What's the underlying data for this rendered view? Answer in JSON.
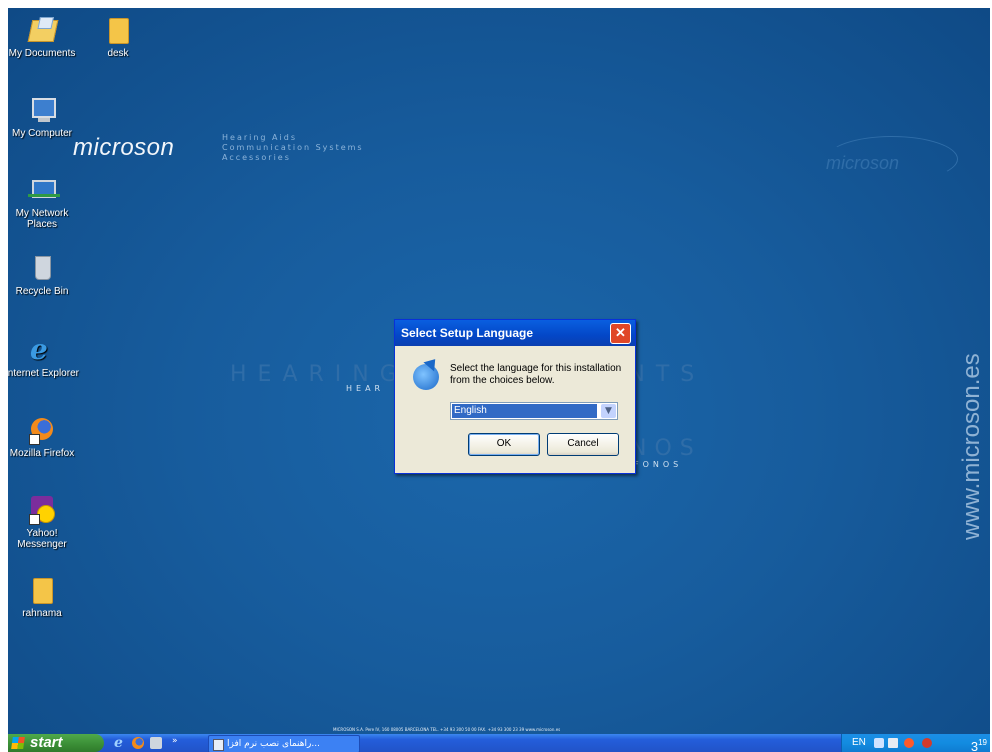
{
  "desktop": {
    "icons": [
      {
        "label": "My Documents"
      },
      {
        "label": "desk"
      },
      {
        "label": "My Computer"
      },
      {
        "label": "My Network Places"
      },
      {
        "label": "Recycle Bin"
      },
      {
        "label": "Internet Explorer"
      },
      {
        "label": "Mozilla Firefox"
      },
      {
        "label": "Yahoo! Messenger"
      },
      {
        "label": "rahnama"
      }
    ]
  },
  "wallpaper": {
    "logo": "microson",
    "tagline": [
      "Hearing Aids",
      "Communication Systems",
      "Accessories"
    ],
    "logo_right": "microson",
    "hearing_big": "HEARING INSTRUMENTS",
    "hearing_small": "HEAR",
    "fonos_big": "NOS",
    "fonos_small": "FONOS",
    "website": "www.microson.es",
    "footer": "MICROSON S.A. Pere IV, 160 08005 BARCELONA TEL. +34 93 300 50 00 FAX. +34 93 300 23 39 www.microson.es"
  },
  "dialog": {
    "title": "Select Setup Language",
    "message": "Select the language for this installation from the choices below.",
    "selected_language": "English",
    "ok_label": "OK",
    "cancel_label": "Cancel"
  },
  "taskbar": {
    "start_label": "start",
    "task_label": "راهنمای نصب نرم افزا...",
    "language": "EN",
    "clock": "3",
    "clock_minutes": "19"
  },
  "colors": {
    "desktop_bg": "#175c9d",
    "titlebar": "#0347c7",
    "start_button": "#3a8d35",
    "taskbar": "#245edb"
  }
}
